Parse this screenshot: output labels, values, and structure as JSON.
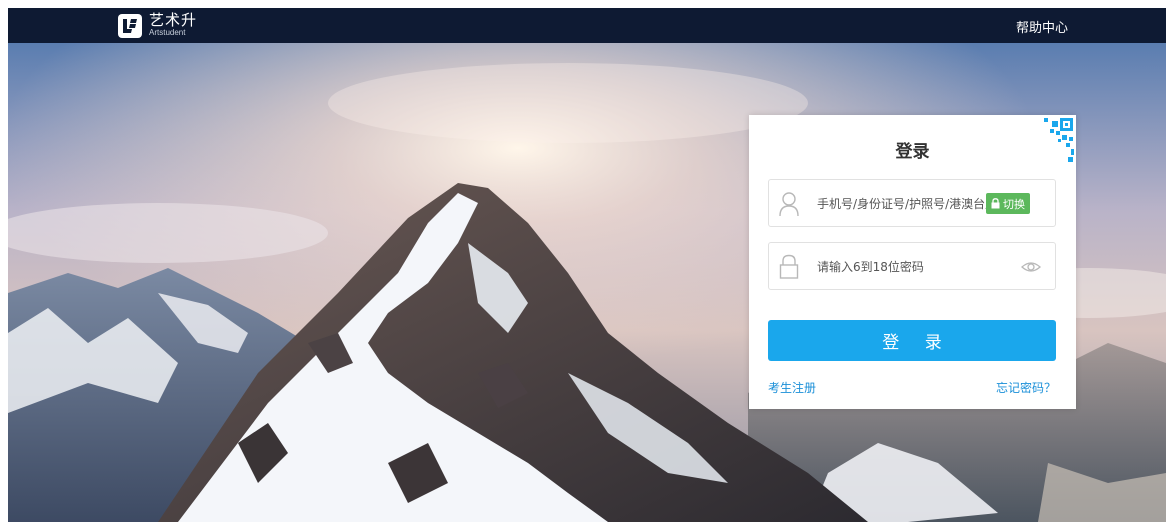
{
  "header": {
    "logo_cn": "艺术升",
    "logo_en": "Artstudent",
    "help_label": "帮助中心"
  },
  "login": {
    "title": "登录",
    "account_placeholder": "手机号/身份证号/护照号/港澳台居民身份证号",
    "switch_label": "切换",
    "password_placeholder": "请输入6到18位密码",
    "submit_label": "登 录",
    "register_label": "考生注册",
    "forgot_label": "忘记密码？"
  },
  "colors": {
    "topbar": "#0e1a33",
    "primary": "#1aa7ec",
    "link": "#1a8fd8",
    "switch": "#5cb85c"
  },
  "icons": {
    "logo": "artstudent-logo-icon",
    "account": "user-icon",
    "password": "lock-icon",
    "visibility": "eye-icon",
    "qr": "qr-code-icon",
    "switch": "lock-small-icon"
  }
}
